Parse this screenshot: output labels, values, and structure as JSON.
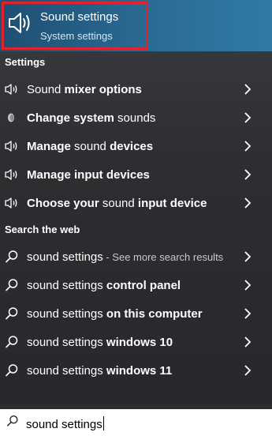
{
  "best_match": {
    "title": "Sound settings",
    "subtitle": "System settings",
    "icon": "speaker-icon"
  },
  "settings_section": {
    "heading": "Settings",
    "items": [
      {
        "icon": "speaker-icon",
        "normal_before": "Sound ",
        "bold": "mixer options",
        "normal_after": "",
        "bold2": ""
      },
      {
        "icon": "sound-settings-icon",
        "normal_before": "",
        "bold": "Change system",
        "normal_after": " sounds",
        "bold2": ""
      },
      {
        "icon": "speaker-icon",
        "normal_before": "",
        "bold": "Manage",
        "normal_after": " sound ",
        "bold2": "devices"
      },
      {
        "icon": "speaker-icon",
        "normal_before": "",
        "bold": "Manage input devices",
        "normal_after": "",
        "bold2": ""
      },
      {
        "icon": "speaker-icon",
        "normal_before": "",
        "bold": "Choose your",
        "normal_after": " sound ",
        "bold2": "input device"
      }
    ]
  },
  "web_section": {
    "heading": "Search the web",
    "items": [
      {
        "icon": "search-icon",
        "normal": "sound settings",
        "bold": "",
        "muted": " - See more search results"
      },
      {
        "icon": "search-icon",
        "normal": "sound settings ",
        "bold": "control panel",
        "muted": ""
      },
      {
        "icon": "search-icon",
        "normal": "sound settings ",
        "bold": "on this computer",
        "muted": ""
      },
      {
        "icon": "search-icon",
        "normal": "sound settings ",
        "bold": "windows 10",
        "muted": ""
      },
      {
        "icon": "search-icon",
        "normal": "sound settings ",
        "bold": "windows 11",
        "muted": ""
      }
    ]
  },
  "search": {
    "value": "sound settings",
    "icon": "search-icon"
  },
  "colors": {
    "highlight_border": "#e0232f",
    "banner": "#2a6b93"
  }
}
